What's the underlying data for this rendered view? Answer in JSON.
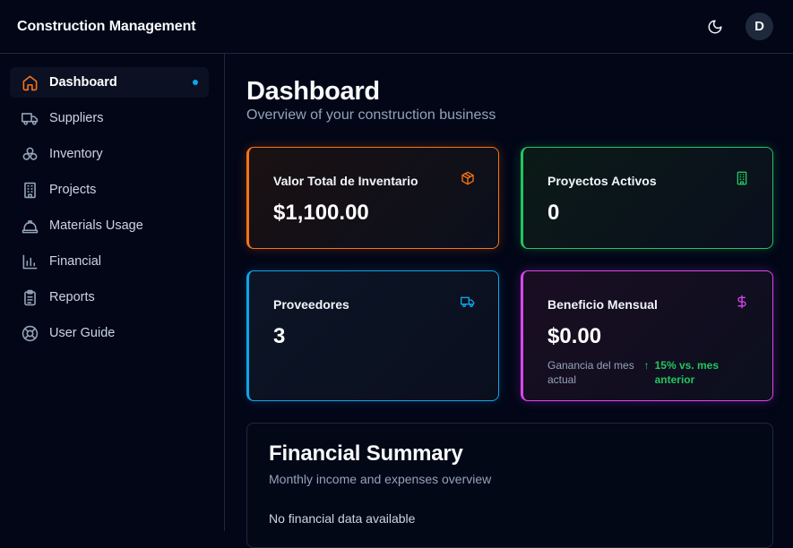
{
  "app": {
    "title": "Construction Management"
  },
  "header": {
    "avatar_initial": "D"
  },
  "sidebar": {
    "items": [
      {
        "label": "Dashboard",
        "icon": "home-icon",
        "active": true
      },
      {
        "label": "Suppliers",
        "icon": "truck-icon"
      },
      {
        "label": "Inventory",
        "icon": "boxes-icon"
      },
      {
        "label": "Projects",
        "icon": "building-icon"
      },
      {
        "label": "Materials Usage",
        "icon": "hard-hat-icon"
      },
      {
        "label": "Financial",
        "icon": "bar-chart-icon"
      },
      {
        "label": "Reports",
        "icon": "clipboard-icon"
      },
      {
        "label": "User Guide",
        "icon": "lifebuoy-icon"
      }
    ]
  },
  "main": {
    "title": "Dashboard",
    "subtitle": "Overview of your construction business",
    "cards": {
      "inventory": {
        "label": "Valor Total de Inventario",
        "value": "$1,100.00",
        "icon": "package-icon",
        "color": "#f97316"
      },
      "projects": {
        "label": "Proyectos Activos",
        "value": "0",
        "icon": "building-icon",
        "color": "#22c55e"
      },
      "suppliers": {
        "label": "Proveedores",
        "value": "3",
        "icon": "truck-icon",
        "color": "#0ea5e9"
      },
      "profit": {
        "label": "Beneficio Mensual",
        "value": "$0.00",
        "icon": "dollar-icon",
        "color": "#d946ef",
        "note": "Ganancia del mes actual",
        "trend": "15% vs. mes anterior"
      }
    },
    "financial": {
      "title": "Financial Summary",
      "subtitle": "Monthly income and expenses overview",
      "empty": "No financial data available"
    }
  }
}
